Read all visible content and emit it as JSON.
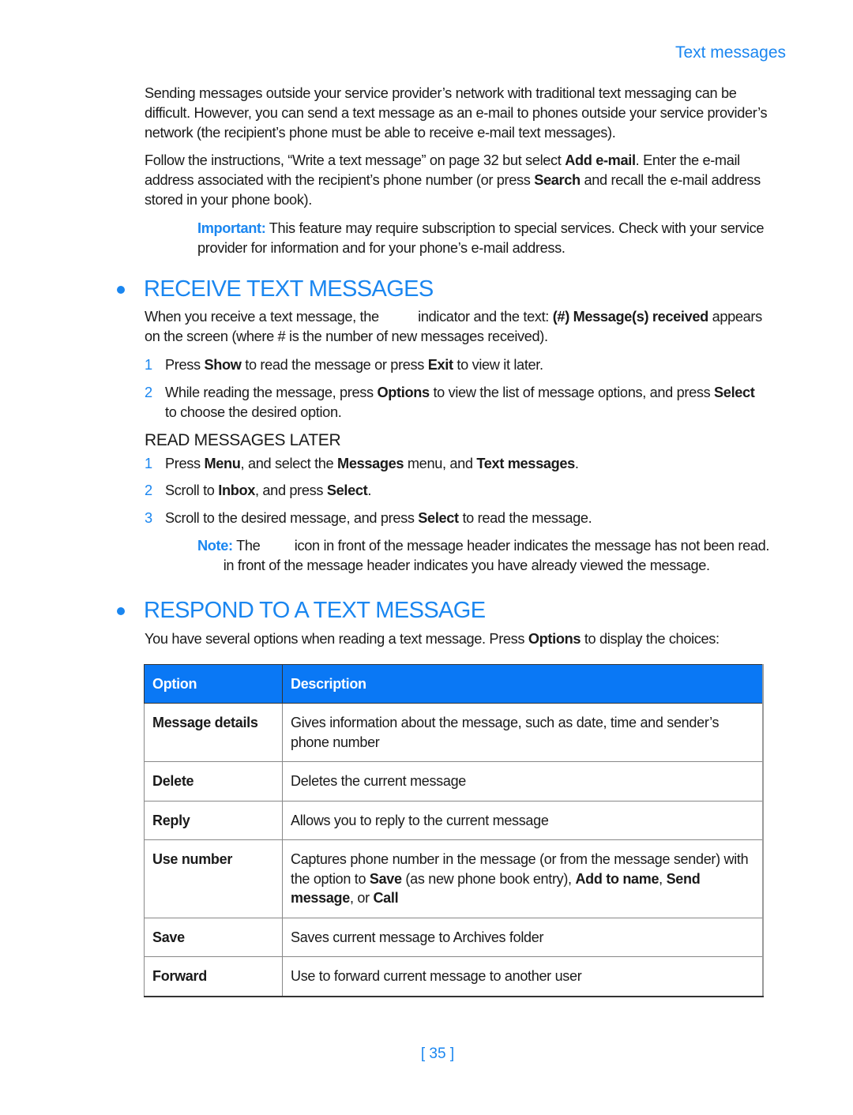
{
  "running_head": "Text messages",
  "intro": {
    "para1": "Sending messages outside your service provider’s network with traditional text messaging can be difficult. However, you can send a text message as an e-mail to phones outside your service provider’s network (the recipient’s phone must be able to receive e-mail text messages).",
    "para2_a": "Follow the instructions, “Write a text message” on page 32 but select ",
    "para2_b": "Add e-mail",
    "para2_c": ". Enter the e-mail address associated with the recipient’s phone number (or press ",
    "para2_d": "Search",
    "para2_e": " and recall the e-mail address stored in your phone book).",
    "important_label": "Important:",
    "important_text": " This feature may require subscription to special services. Check with your service provider for information and for your phone’s e-mail address."
  },
  "receive": {
    "heading": "RECEIVE TEXT MESSAGES",
    "para_a": "When you receive a text message, the ",
    "para_icon": "message-indicator-icon",
    "para_b": " indicator and the text: ",
    "para_c": "(#) Message(s) received",
    "para_d": " appears on the screen (where # is the number of new messages received).",
    "steps": [
      {
        "num": "1",
        "a": "Press ",
        "b": "Show",
        "c": " to read the message or press ",
        "d": "Exit",
        "e": " to view it later."
      },
      {
        "num": "2",
        "a": "While reading the message, press ",
        "b": "Options",
        "c": " to view the list of message options, and press ",
        "d": "Select",
        "e": " to choose the desired option."
      }
    ]
  },
  "read_later": {
    "heading": "READ MESSAGES LATER",
    "step1": {
      "num": "1",
      "a": "Press ",
      "b": "Menu",
      "c": ", and select the ",
      "d": "Messages",
      "e": " menu, and ",
      "f": "Text messages",
      "g": "."
    },
    "step2": {
      "num": "2",
      "a": "Scroll to ",
      "b": "Inbox",
      "c": ", and press ",
      "d": "Select",
      "e": "."
    },
    "step3": {
      "num": "3",
      "a": "Scroll to the desired message, and press ",
      "b": "Select",
      "c": " to read the message."
    },
    "note_label": "Note:",
    "note_a": " The ",
    "note_b": " icon in front of the message header indicates the message has not been read. ",
    "note_c": " in front of the message header indicates you have already viewed the message."
  },
  "respond": {
    "heading": "RESPOND TO A TEXT MESSAGE",
    "intro_a": "You have several options when reading a text message. Press ",
    "intro_b": "Options",
    "intro_c": " to display the choices:",
    "table": {
      "headers": [
        "Option",
        "Description"
      ],
      "rows": [
        {
          "option": "Message details",
          "desc": "Gives information about the message, such as date, time and sender’s phone number"
        },
        {
          "option": "Delete",
          "desc": "Deletes the current message"
        },
        {
          "option": "Reply",
          "desc": "Allows you to reply to the current message"
        },
        {
          "option": "Use number",
          "desc_a": "Captures phone number in the message (or from the message sender) with the option to ",
          "desc_b": "Save",
          "desc_c": " (as new phone book entry), ",
          "desc_d": "Add to name",
          "desc_e": ", ",
          "desc_f": "Send message",
          "desc_g": ", or ",
          "desc_h": "Call"
        },
        {
          "option": "Save",
          "desc": "Saves current message to Archives folder"
        },
        {
          "option": "Forward",
          "desc": "Use to forward current message to another user"
        }
      ]
    }
  },
  "page_number": "[ 35 ]",
  "colors": {
    "accent": "#1a86f0",
    "table_header": "#0a78f5"
  }
}
